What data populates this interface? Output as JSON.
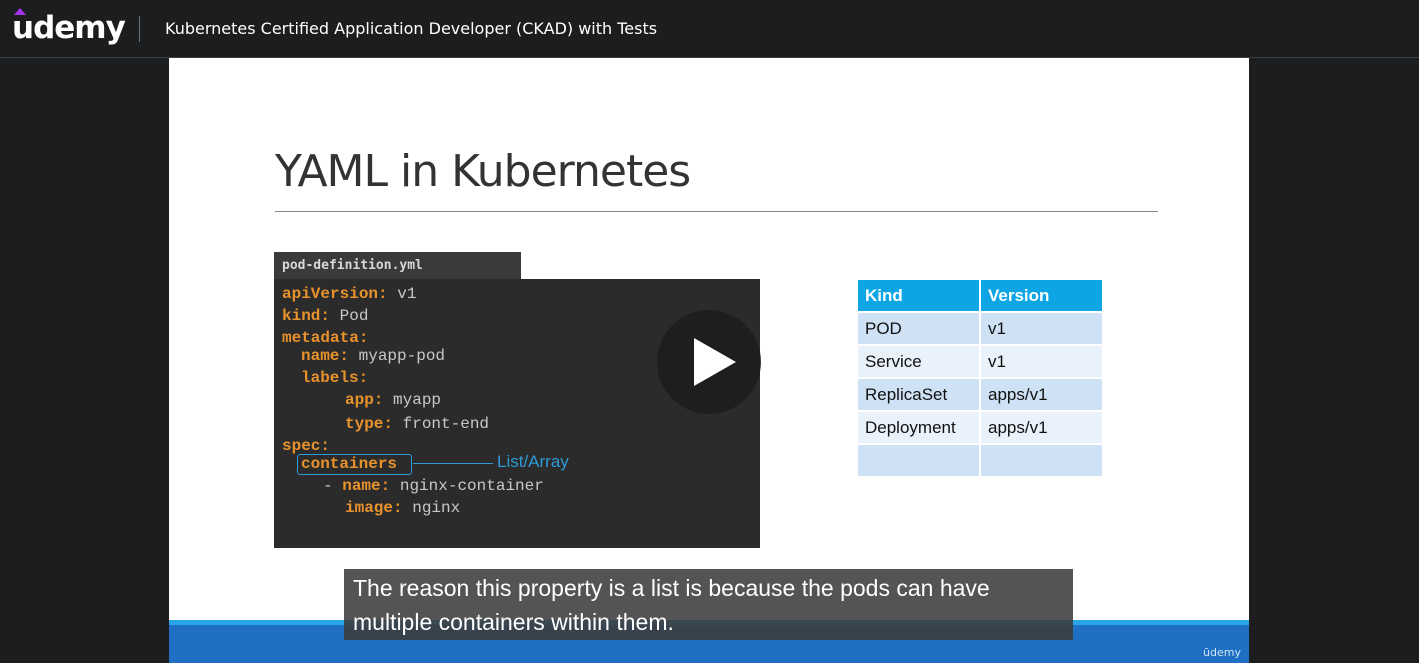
{
  "header": {
    "logo_text": "udemy",
    "course_title": "Kubernetes Certified Application Developer (CKAD) with Tests"
  },
  "slide": {
    "title": "YAML in Kubernetes",
    "file_name": "pod-definition.yml",
    "code": [
      {
        "key": "apiVersion:",
        "value": " v1"
      },
      {
        "key": "kind:",
        "value": " Pod"
      },
      {
        "key": "metadata:",
        "value": ""
      },
      {
        "key": "name:",
        "value": " myapp-pod"
      },
      {
        "key": "labels:",
        "value": ""
      },
      {
        "key": "app:",
        "value": " myapp"
      },
      {
        "key": "type:",
        "value": " front-end"
      },
      {
        "key": "spec:",
        "value": ""
      },
      {
        "key": "containers",
        "value": ""
      },
      {
        "key": "name:",
        "value": " nginx-container"
      },
      {
        "key": "image:",
        "value": " nginx"
      }
    ],
    "list_item_dash": "-",
    "annotation": "List/Array",
    "table": {
      "headers": [
        "Kind",
        "Version"
      ],
      "rows": [
        [
          "POD",
          "v1"
        ],
        [
          "Service",
          "v1"
        ],
        [
          "ReplicaSet",
          "apps/v1"
        ],
        [
          "Deployment",
          "apps/v1"
        ],
        [
          "",
          ""
        ]
      ]
    },
    "watermark": "ūdemy"
  },
  "caption": {
    "line1": "The reason this property is a list is because the pods can have",
    "line2": "multiple containers within them."
  },
  "colors": {
    "code_key": "#e8922c",
    "table_header": "#0ea5e5",
    "annotation": "#2e9ad8",
    "bottom_band": "#1f6fc3"
  }
}
